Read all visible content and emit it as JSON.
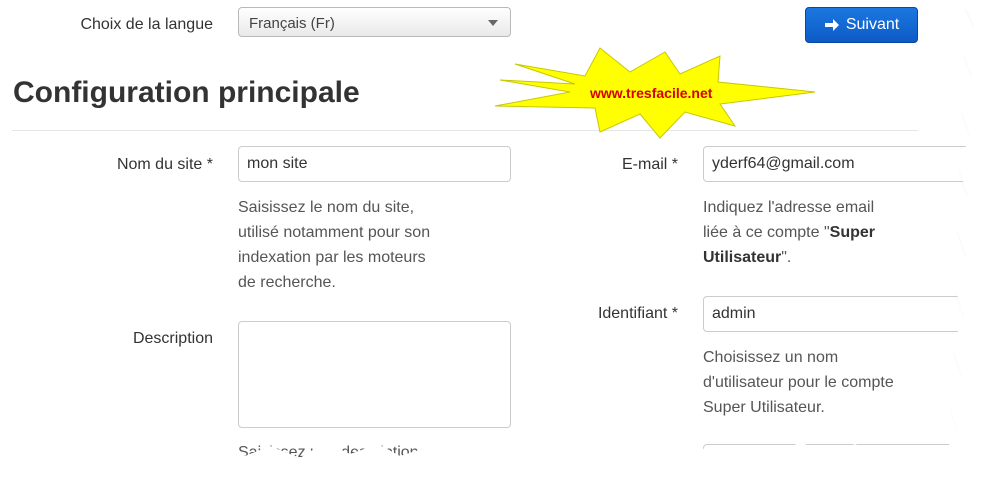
{
  "language": {
    "label": "Choix de la langue",
    "selected": "Français (Fr)"
  },
  "next_button": {
    "label": "Suivant",
    "icon": "arrow-right-icon"
  },
  "section_title": "Configuration principale",
  "watermark": "www.tresfacile.net",
  "site_name": {
    "label": "Nom du site *",
    "value": "mon site",
    "help": [
      "Saisissez le nom du site,",
      "utilisé notamment pour son",
      "indexation par les moteurs",
      "de recherche."
    ]
  },
  "description": {
    "label": "Description",
    "value": "",
    "help_partial": "Saisissez une description"
  },
  "email": {
    "label": "E-mail *",
    "value": "yderf64@gmail.com",
    "help_line1": "Indiquez l'adresse email",
    "help_line2_pre": "liée à ce compte \"",
    "help_line2_bold": "Super",
    "help_line3_bold": "Utilisateur",
    "help_line3_post": "\"."
  },
  "username": {
    "label": "Identifiant *",
    "value": "admin",
    "help": [
      "Choisissez un nom",
      "d'utilisateur pour le compte",
      "Super Utilisateur."
    ]
  },
  "colors": {
    "primary_button": "#0d5bc6",
    "burst_fill": "#ffff00",
    "watermark_text": "#d60000"
  }
}
